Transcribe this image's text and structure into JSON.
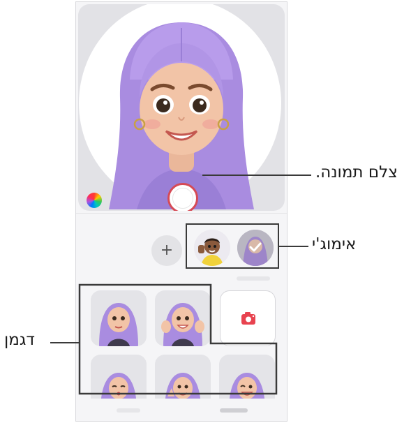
{
  "preview": {
    "avatar_icon": "purple-haired-avatar-illustration",
    "color_picker_icon": "color-wheel-icon",
    "shutter_icon": "shutter-button-icon"
  },
  "emoji_bar": {
    "add_label": "+",
    "add_icon": "plus-icon",
    "avatar1_icon": "dark-haired-avatar-waving",
    "avatar2_icon": "purple-avatar-selected"
  },
  "stickers": {
    "camera_icon": "camera-icon",
    "items": [
      "sticker-pose-1",
      "sticker-pose-2",
      "sticker-pose-3",
      "sticker-pose-4",
      "sticker-pose-5"
    ]
  },
  "callouts": {
    "take_photo": "צלם תמונה.",
    "emoji": "אימוג'י",
    "mode": "דגמן"
  },
  "colors": {
    "hair": "#a98ce0",
    "skin": "#f2c4a7",
    "shutter_ring": "#d64a55",
    "camera_red": "#e8434f",
    "frame": "#f5f5f7"
  }
}
